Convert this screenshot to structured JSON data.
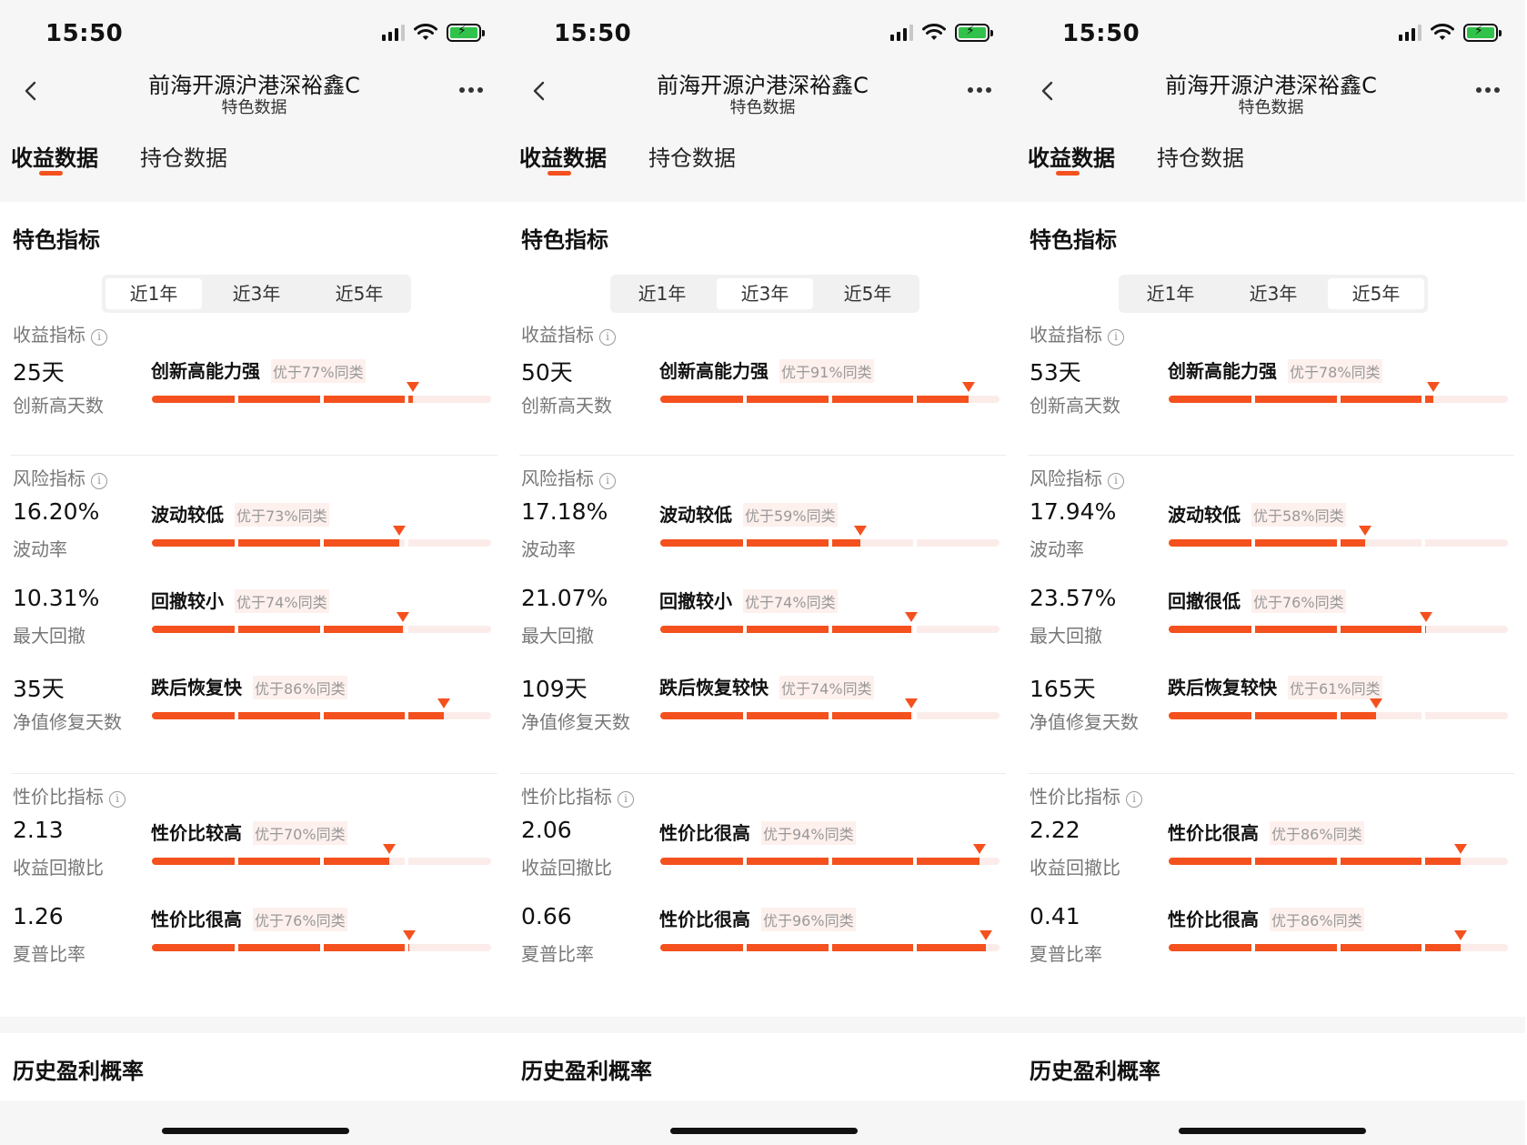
{
  "status": {
    "time": "15:50"
  },
  "nav": {
    "title": "前海开源沪港深裕鑫C",
    "subtitle": "特色数据"
  },
  "tabs": [
    "收益数据",
    "持仓数据"
  ],
  "section_title": "特色指标",
  "periods": [
    "近1年",
    "近3年",
    "近5年"
  ],
  "groups": {
    "return": "收益指标",
    "risk": "风险指标",
    "value": "性价比指标"
  },
  "history_title": "历史盈利概率",
  "info_glyph": "i",
  "colors": {
    "accent": "#f4511e",
    "bar_track": "#fbecea",
    "battery": "#30c24a"
  },
  "screens": [
    {
      "selected_period": "近1年",
      "metrics": [
        {
          "value": "25天",
          "name": "创新高天数",
          "tag": "创新高能力强",
          "better": "优于77%同类",
          "percent": 77
        },
        {
          "value": "16.20%",
          "name": "波动率",
          "tag": "波动较低",
          "better": "优于73%同类",
          "percent": 73
        },
        {
          "value": "10.31%",
          "name": "最大回撤",
          "tag": "回撤较小",
          "better": "优于74%同类",
          "percent": 74
        },
        {
          "value": "35天",
          "name": "净值修复天数",
          "tag": "跌后恢复快",
          "better": "优于86%同类",
          "percent": 86
        },
        {
          "value": "2.13",
          "name": "收益回撤比",
          "tag": "性价比较高",
          "better": "优于70%同类",
          "percent": 70
        },
        {
          "value": "1.26",
          "name": "夏普比率",
          "tag": "性价比很高",
          "better": "优于76%同类",
          "percent": 76
        }
      ]
    },
    {
      "selected_period": "近3年",
      "metrics": [
        {
          "value": "50天",
          "name": "创新高天数",
          "tag": "创新高能力强",
          "better": "优于91%同类",
          "percent": 91
        },
        {
          "value": "17.18%",
          "name": "波动率",
          "tag": "波动较低",
          "better": "优于59%同类",
          "percent": 59
        },
        {
          "value": "21.07%",
          "name": "最大回撤",
          "tag": "回撤较小",
          "better": "优于74%同类",
          "percent": 74
        },
        {
          "value": "109天",
          "name": "净值修复天数",
          "tag": "跌后恢复较快",
          "better": "优于74%同类",
          "percent": 74
        },
        {
          "value": "2.06",
          "name": "收益回撤比",
          "tag": "性价比很高",
          "better": "优于94%同类",
          "percent": 94
        },
        {
          "value": "0.66",
          "name": "夏普比率",
          "tag": "性价比很高",
          "better": "优于96%同类",
          "percent": 96
        }
      ]
    },
    {
      "selected_period": "近5年",
      "metrics": [
        {
          "value": "53天",
          "name": "创新高天数",
          "tag": "创新高能力强",
          "better": "优于78%同类",
          "percent": 78
        },
        {
          "value": "17.94%",
          "name": "波动率",
          "tag": "波动较低",
          "better": "优于58%同类",
          "percent": 58
        },
        {
          "value": "23.57%",
          "name": "最大回撤",
          "tag": "回撤很低",
          "better": "优于76%同类",
          "percent": 76
        },
        {
          "value": "165天",
          "name": "净值修复天数",
          "tag": "跌后恢复较快",
          "better": "优于61%同类",
          "percent": 61
        },
        {
          "value": "2.22",
          "name": "收益回撤比",
          "tag": "性价比很高",
          "better": "优于86%同类",
          "percent": 86
        },
        {
          "value": "0.41",
          "name": "夏普比率",
          "tag": "性价比很高",
          "better": "优于86%同类",
          "percent": 86
        }
      ]
    }
  ]
}
